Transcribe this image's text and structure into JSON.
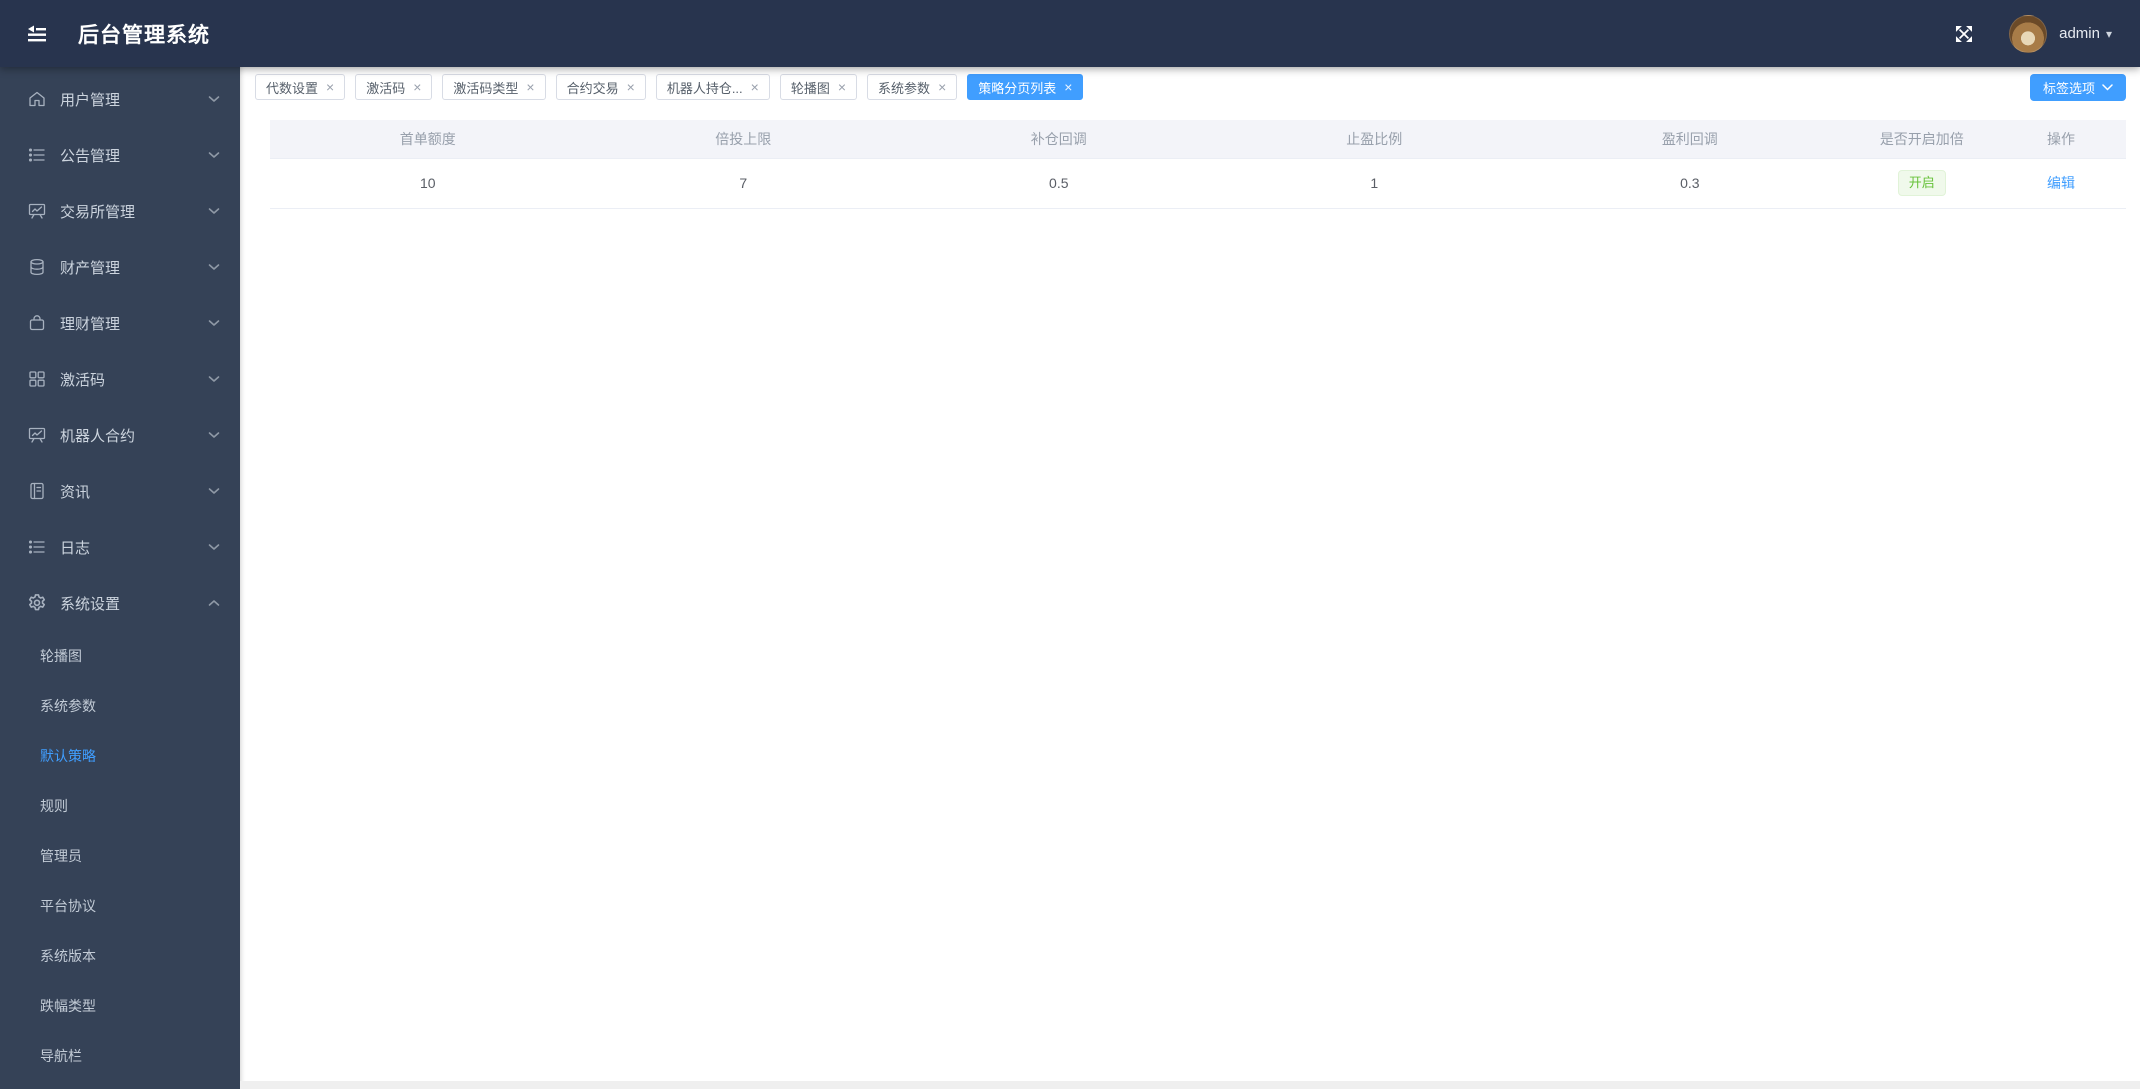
{
  "app": {
    "title": "后台管理系统",
    "user": "admin"
  },
  "icons": {
    "close": "×",
    "caret_down": "▾"
  },
  "sidebar": {
    "items": [
      {
        "label": "用户管理"
      },
      {
        "label": "公告管理"
      },
      {
        "label": "交易所管理"
      },
      {
        "label": "财产管理"
      },
      {
        "label": "理财管理"
      },
      {
        "label": "激活码"
      },
      {
        "label": "机器人合约"
      },
      {
        "label": "资讯"
      },
      {
        "label": "日志"
      },
      {
        "label": "系统设置"
      }
    ],
    "sub_items": [
      {
        "label": "轮播图"
      },
      {
        "label": "系统参数"
      },
      {
        "label": "默认策略",
        "active": true
      },
      {
        "label": "规则"
      },
      {
        "label": "管理员"
      },
      {
        "label": "平台协议"
      },
      {
        "label": "系统版本"
      },
      {
        "label": "跌幅类型"
      },
      {
        "label": "导航栏"
      }
    ]
  },
  "tabbar": {
    "tabs": [
      {
        "label": "代数设置"
      },
      {
        "label": "激活码"
      },
      {
        "label": "激活码类型"
      },
      {
        "label": "合约交易"
      },
      {
        "label": "机器人持仓..."
      },
      {
        "label": "轮播图"
      },
      {
        "label": "系统参数"
      },
      {
        "label": "策略分页列表",
        "active": true
      }
    ],
    "options_button": "标签选项"
  },
  "table": {
    "columns": [
      "首单额度",
      "倍投上限",
      "补仓回调",
      "止盈比例",
      "盈利回调",
      "是否开启加倍",
      "操作"
    ],
    "row": {
      "values": [
        "10",
        "7",
        "0.5",
        "1",
        "0.3"
      ],
      "status": "开启",
      "action": "编辑"
    }
  },
  "colors": {
    "accent": "#409eff",
    "success": "#67c23a",
    "header_bg": "#28344e",
    "sidebar_bg": "#354257"
  }
}
